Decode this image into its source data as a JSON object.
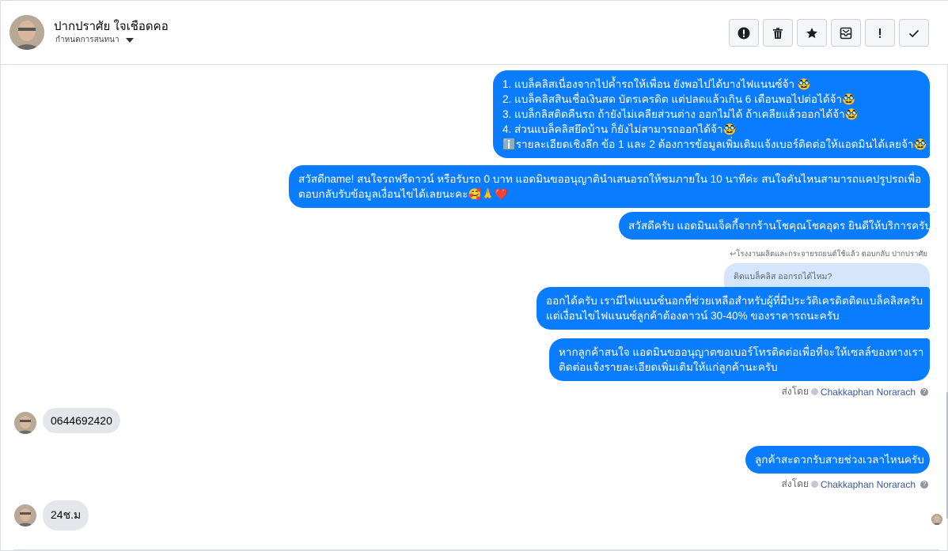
{
  "header": {
    "contact_name": "ปากปราศัย ใจเชือดคอ",
    "sub_label": "กำหนดการสนทนา",
    "toolbar": [
      {
        "name": "report-spam-button",
        "icon": "alert-circle-icon"
      },
      {
        "name": "delete-button",
        "icon": "trash-icon"
      },
      {
        "name": "star-button",
        "icon": "star-icon"
      },
      {
        "name": "mark-unread-button",
        "icon": "envelope-icon"
      },
      {
        "name": "flag-important-button",
        "icon": "exclamation-icon"
      },
      {
        "name": "mark-done-button",
        "icon": "check-icon"
      }
    ]
  },
  "messages": {
    "m1": [
      "1. แบล็คลิสเนื่องจากไปค้ำรถให้เพื่อน ยังพอไปได้บางไฟแนนซ์จ้า 🥸",
      "2. แบล็คลิสสินเชื่อเงินสด บัตรเครดิต แต่ปลดแล้วเกิน 6 เดือนพอไปต่อได้จ้า🥸",
      "3. แบล็กลิสติดคืนรถ ถ้ายังไม่เคลียส่วนต่าง ออกไม่ได้ ถ้าเคลียแล้วออกได้จ้า🥸",
      "4. ส่วนแบล็คลิสยึดบ้าน ก็ยังไม่สามารถออกได้จ้า🥸",
      "ℹ️รายละเอียดเชิงลึก ข้อ 1 และ 2 ต้องการข้อมูลเพิ่มเติมแจ้งเบอร์ติดต่อให้แอดมินได้เลยจ้า🥸"
    ],
    "m2": [
      "สวัสดีname! สนใจรถฟรีดาวน์ หรือรับรถ 0 บาท แอดมินขออนุญาตินำเสนอรถให้ชมภายใน 10 นาทีค่ะ สนใจคันไหนสามารถแคปรูปรถเพื่อ",
      "ตอบกลับรับข้อมูลเงื่อนไขได้เลยนะคะ🥰🙏❤️"
    ],
    "m3": "สวัสดีครับ แอดมินแจ็คกี้จากร้านโชคุณโชคอุดร ยินดีให้บริการครับ",
    "reply_note": "↩โรงงานผลิตและกระจายรถยนต์ใช้แล้ว ตอบกลับ ปากปราศัย",
    "quoted": "ติดแบล็คลิส ออกรถได้ไหม?",
    "m4": [
      "ออกได้ครับ เรามีไฟแนนซ์นอกที่ช่วยเหลือสำหรับผู้ที่มีประวัติเครดิตติดแบล็คลิสครับ",
      "แต่เงื่อนไขไฟแนนซ์ลูกค้าต้องดาวน์ 30-40% ของราคารถนะครับ"
    ],
    "m5": [
      "หากลูกค้าสนใจ แอดมินขออนุญาตขอเบอร์โทรติดต่อเพื่อที่จะให้เซลล์ของทางเรา",
      "ติดต่อแจ้งรายละเอียดเพิ่มเติมให้แก่ลูกค้านะครับ"
    ],
    "sent_by_label": "ส่งโดย",
    "sender_name": "Chakkaphan Norarach",
    "in1": "0644692420",
    "m6": "ลูกค้าสะดวกรับสายช่วงเวลาไหนครับ",
    "in2": "24ช.ม"
  },
  "colors": {
    "outgoing_bubble": "#0a7cff",
    "incoming_bubble": "#e4e6eb",
    "quoted_bubble": "#d4e5fc"
  }
}
